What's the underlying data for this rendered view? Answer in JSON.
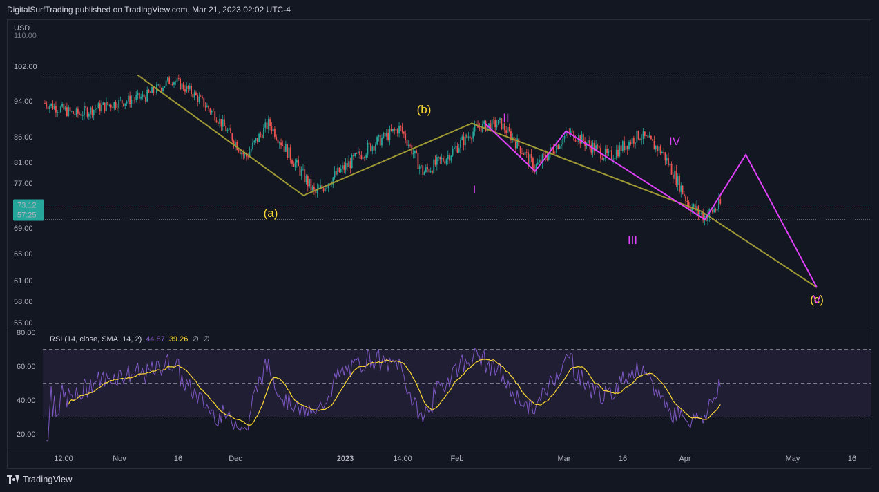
{
  "header": {
    "publish_text": "DigitalSurfTrading published on TradingView.com, Mar 21, 2023 02:02 UTC-4"
  },
  "footer": {
    "brand": "TradingView"
  },
  "colors": {
    "background": "#131722",
    "up": "#26a69a",
    "down": "#ef5350",
    "rsi_line": "#7e57c2",
    "rsi_ma": "#fdd835",
    "rsi_band": "#2a2540",
    "wave_yellow": "#fdd835",
    "wave_magenta": "#e040fb",
    "trend": "#a09a35",
    "price_badge": "#26a69a"
  },
  "chart_data": {
    "type": "candlestick",
    "price_axis": {
      "unit_label": "USD",
      "ticks": [
        102.0,
        94.0,
        86.0,
        81.0,
        77.0,
        69.0,
        65.0,
        61.0,
        58.0,
        55.0
      ],
      "top_partial_tick": "110.00",
      "current_price": "73.12",
      "countdown": "57:25",
      "reference_levels": [
        99.5,
        70.5
      ]
    },
    "time_axis": {
      "ticks": [
        "12:00",
        "Nov",
        "16",
        "Dec",
        "2023",
        "14:00",
        "Feb",
        "Mar",
        "16",
        "Apr",
        "May",
        "16"
      ]
    },
    "price_path_anchors": [
      {
        "t": 0.0,
        "p": 93.5
      },
      {
        "t": 0.04,
        "p": 91.0
      },
      {
        "t": 0.08,
        "p": 93.0
      },
      {
        "t": 0.13,
        "p": 95.0
      },
      {
        "t": 0.165,
        "p": 99.0
      },
      {
        "t": 0.19,
        "p": 96.0
      },
      {
        "t": 0.22,
        "p": 91.0
      },
      {
        "t": 0.26,
        "p": 82.0
      },
      {
        "t": 0.29,
        "p": 89.0
      },
      {
        "t": 0.31,
        "p": 84.0
      },
      {
        "t": 0.35,
        "p": 75.0
      },
      {
        "t": 0.38,
        "p": 79.0
      },
      {
        "t": 0.42,
        "p": 84.0
      },
      {
        "t": 0.46,
        "p": 88.0
      },
      {
        "t": 0.49,
        "p": 79.0
      },
      {
        "t": 0.52,
        "p": 82.0
      },
      {
        "t": 0.56,
        "p": 88.0
      },
      {
        "t": 0.59,
        "p": 89.0
      },
      {
        "t": 0.635,
        "p": 80.0
      },
      {
        "t": 0.68,
        "p": 87.0
      },
      {
        "t": 0.73,
        "p": 82.0
      },
      {
        "t": 0.77,
        "p": 86.5
      },
      {
        "t": 0.8,
        "p": 83.0
      },
      {
        "t": 0.835,
        "p": 73.0
      },
      {
        "t": 0.855,
        "p": 71.0
      },
      {
        "t": 0.875,
        "p": 73.1
      }
    ],
    "wave_labels": [
      {
        "text": "(a)",
        "color": "yellow",
        "t": "Dec 2022",
        "p": 72.0
      },
      {
        "text": "(b)",
        "color": "yellow",
        "t": "Jan 2023",
        "p": 91.5
      },
      {
        "text": "(c)",
        "color": "yellow",
        "t": "May 2023",
        "p": 57.5
      },
      {
        "text": "I",
        "color": "magenta",
        "t": "Feb 2023",
        "p": 76.0
      },
      {
        "text": "II",
        "color": "magenta",
        "t": "Feb 2023",
        "p": 90.5
      },
      {
        "text": "III",
        "color": "magenta",
        "t": "Mar 2023",
        "p": 67.0
      },
      {
        "text": "IV",
        "color": "magenta",
        "t": "Apr 2023",
        "p": 84.5
      },
      {
        "text": "V",
        "color": "magenta",
        "t": "May 2023",
        "p": 57.5
      }
    ],
    "yellow_path": [
      {
        "t": 0.12,
        "p": 100.0
      },
      {
        "t": 0.335,
        "p": 74.8
      },
      {
        "t": 0.553,
        "p": 89.0
      },
      {
        "t": 0.85,
        "p": 72.0
      },
      {
        "t": 1.0,
        "p": 60.0
      }
    ],
    "magenta_path": [
      {
        "t": 0.57,
        "p": 89.0
      },
      {
        "t": 0.635,
        "p": 79.3
      },
      {
        "t": 0.675,
        "p": 87.3
      },
      {
        "t": 0.855,
        "p": 70.5
      },
      {
        "t": 0.908,
        "p": 82.5
      },
      {
        "t": 1.0,
        "p": 60.0
      }
    ],
    "rsi": {
      "label": "RSI (14, close, SMA, 14, 2)",
      "value": "44.87",
      "ma_value": "39.26",
      "extra_1": "∅",
      "extra_2": "∅",
      "ticks": [
        80.0,
        60.0,
        40.0,
        20.0
      ],
      "bands": [
        70,
        50,
        30
      ]
    }
  }
}
